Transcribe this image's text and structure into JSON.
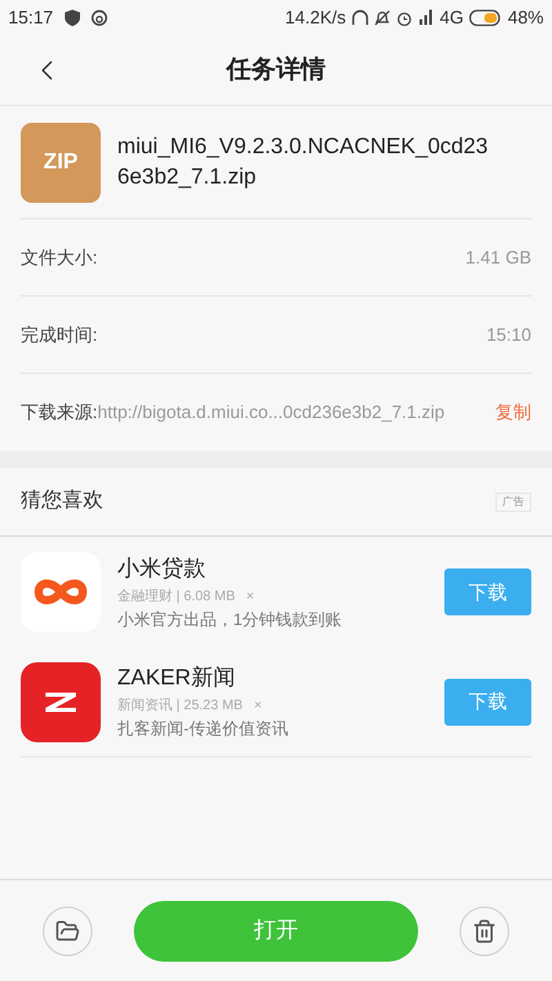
{
  "status_bar": {
    "time": "15:17",
    "speed": "14.2K/s",
    "network": "4G",
    "battery": "48%"
  },
  "header": {
    "title": "任务详情"
  },
  "file": {
    "icon_label": "ZIP",
    "name": "miui_MI6_V9.2.3.0.NCACNEK_0cd236e3b2_7.1.zip"
  },
  "details": [
    {
      "label": "文件大小:",
      "value": "1.41 GB"
    },
    {
      "label": "完成时间:",
      "value": "15:10"
    }
  ],
  "source": {
    "label": "下载来源:",
    "url": "http://bigota.d.miui.co...0cd236e3b2_7.1.zip",
    "action": "复制"
  },
  "recommend": {
    "title": "猜您喜欢",
    "ad_tag": "广告",
    "apps": [
      {
        "name": "小米贷款",
        "meta": "金融理财 | 6.08 MB",
        "close": "×",
        "desc": "小米官方出品，1分钟钱款到账",
        "button": "下载",
        "kind": "infinity"
      },
      {
        "name": "ZAKER新闻",
        "meta": "新闻资讯 | 25.23 MB",
        "close": "×",
        "desc": "扎客新闻-传递价值资讯",
        "button": "下载",
        "kind": "zaker"
      }
    ]
  },
  "bottom": {
    "open_button": "打开"
  }
}
